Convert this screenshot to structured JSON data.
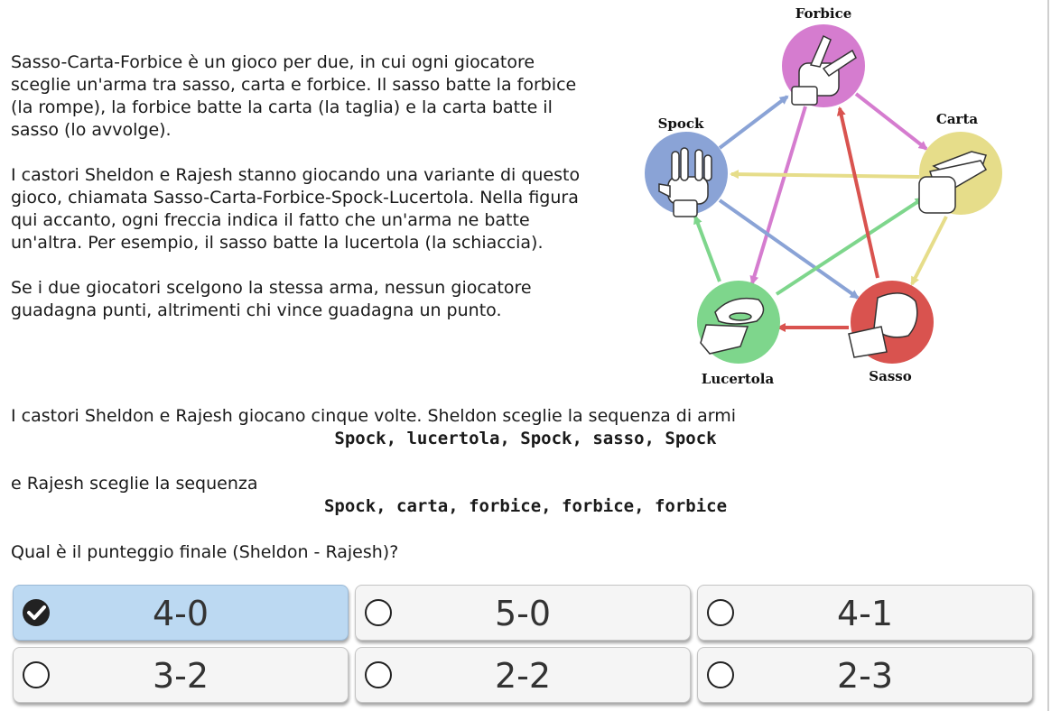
{
  "intro": {
    "p1": "Sasso-Carta-Forbice è un gioco per due, in cui ogni giocatore sceglie un'arma tra sasso, carta e forbice. Il sasso batte la forbice (la rompe), la forbice batte la carta (la taglia) e la carta batte il sasso (lo avvolge).",
    "p2": "I castori Sheldon e Rajesh stanno giocando una variante di questo gioco, chiamata Sasso-Carta-Forbice-Spock-Lucertola. Nella figura qui accanto, ogni freccia indica il fatto che un'arma ne batte un'altra. Per esempio, il sasso batte la lucertola (la schiaccia).",
    "p3": "Se i due giocatori scelgono la stessa arma, nessun giocatore guadagna punti, altrimenti chi vince guadagna un punto."
  },
  "figure": {
    "labels": {
      "forbice": "Forbice",
      "carta": "Carta",
      "spock": "Spock",
      "lucertola": "Lucertola",
      "sasso": "Sasso"
    },
    "colors": {
      "forbice": "#d57ccf",
      "carta": "#e6dd8a",
      "spock": "#8aa3d6",
      "lucertola": "#7ed68c",
      "sasso": "#d9534f"
    }
  },
  "question": {
    "line1": "I castori Sheldon e Rajesh giocano cinque volte. Sheldon sceglie la sequenza di armi",
    "sheldon_sequence": "Spock, lucertola, Spock, sasso, Spock",
    "line2": "e Rajesh sceglie la sequenza",
    "rajesh_sequence": "Spock, carta, forbice, forbice, forbice",
    "prompt": "Qual è il punteggio finale (Sheldon - Rajesh)?"
  },
  "answers": [
    {
      "label": "4-0",
      "selected": true
    },
    {
      "label": "5-0",
      "selected": false
    },
    {
      "label": "4-1",
      "selected": false
    },
    {
      "label": "3-2",
      "selected": false
    },
    {
      "label": "2-2",
      "selected": false
    },
    {
      "label": "2-3",
      "selected": false
    }
  ]
}
